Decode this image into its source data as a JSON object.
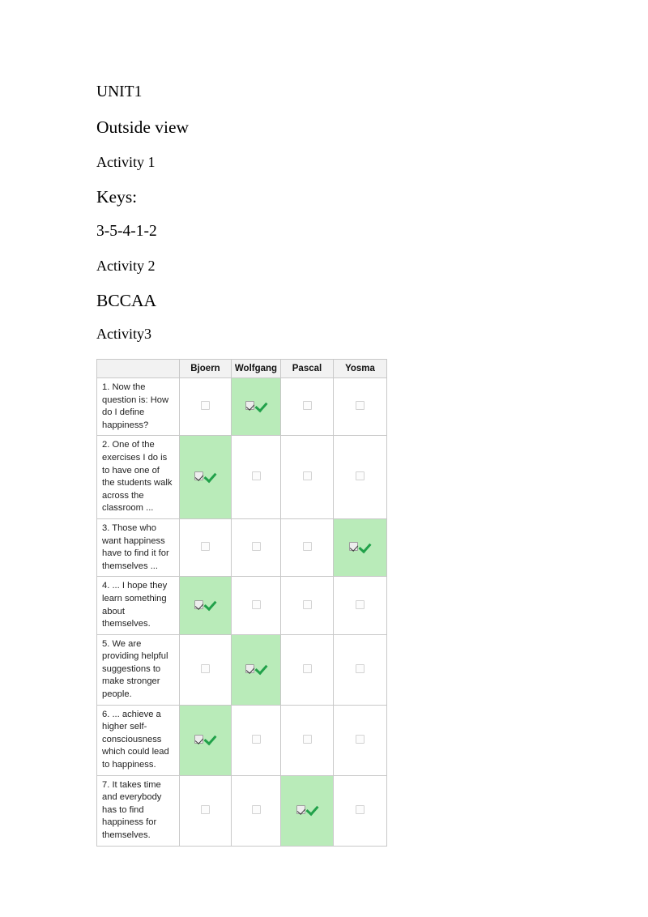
{
  "document": {
    "headings": [
      {
        "id": "unit",
        "text": "UNIT1"
      },
      {
        "id": "section",
        "text": "Outside view"
      },
      {
        "id": "act1",
        "text": "Activity 1"
      },
      {
        "id": "keys",
        "text": "Keys:"
      },
      {
        "id": "keys1",
        "text": "3-5-4-1-2"
      },
      {
        "id": "act2",
        "text": "Activity 2"
      },
      {
        "id": "keys2",
        "text": "BCCAA"
      },
      {
        "id": "act3",
        "text": "Activity3"
      }
    ]
  },
  "table": {
    "columns": [
      "",
      "Bjoern",
      "Wolfgang",
      "Pascal",
      "Yosma"
    ],
    "names": [
      "Bjoern",
      "Wolfgang",
      "Pascal",
      "Yosma"
    ],
    "selected_color": "#b9ebb9",
    "checkmark_color": "#21a14a",
    "header_background": "#f2f2f2",
    "border_color": "#c8c8c8",
    "rows": [
      {
        "statement": "1. Now the question is: How do I define happiness?",
        "answers": [
          false,
          true,
          false,
          false
        ]
      },
      {
        "statement": "2. One of the exercises I do is to have one of the students walk across the classroom ...",
        "answers": [
          true,
          false,
          false,
          false
        ]
      },
      {
        "statement": "3. Those who want happiness have to find it for themselves ...",
        "answers": [
          false,
          false,
          false,
          true
        ]
      },
      {
        "statement": "4. ... I hope they learn something about themselves.",
        "answers": [
          true,
          false,
          false,
          false
        ]
      },
      {
        "statement": "5. We are providing helpful suggestions to make stronger people.",
        "answers": [
          false,
          true,
          false,
          false
        ]
      },
      {
        "statement": "6. ... achieve a higher self-consciousness which could lead to happiness.",
        "answers": [
          true,
          false,
          false,
          false
        ]
      },
      {
        "statement": "7. It takes time and everybody has to find happiness for themselves.",
        "answers": [
          false,
          false,
          true,
          false
        ]
      }
    ]
  }
}
